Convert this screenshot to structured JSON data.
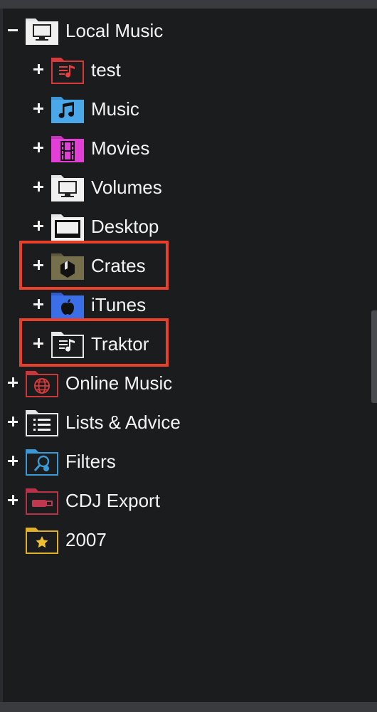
{
  "tree": {
    "items": [
      {
        "label": "Local Music",
        "icon": "computer-folder-icon",
        "expanded": true,
        "level": 0
      },
      {
        "label": "test",
        "icon": "playlist-red-folder-icon",
        "expanded": false,
        "level": 1
      },
      {
        "label": "Music",
        "icon": "music-note-folder-icon",
        "expanded": false,
        "level": 1
      },
      {
        "label": "Movies",
        "icon": "film-folder-icon",
        "expanded": false,
        "level": 1
      },
      {
        "label": "Volumes",
        "icon": "monitor-folder-icon",
        "expanded": false,
        "level": 1
      },
      {
        "label": "Desktop",
        "icon": "desktop-folder-icon",
        "expanded": false,
        "level": 1
      },
      {
        "label": "Crates",
        "icon": "crate-folder-icon",
        "expanded": false,
        "level": 1,
        "highlighted": true
      },
      {
        "label": "iTunes",
        "icon": "apple-folder-icon",
        "expanded": false,
        "level": 1
      },
      {
        "label": "Traktor",
        "icon": "playlist-white-folder-icon",
        "expanded": false,
        "level": 1,
        "highlighted": true
      },
      {
        "label": "Online Music",
        "icon": "globe-folder-icon",
        "expanded": false,
        "level": 0
      },
      {
        "label": "Lists & Advice",
        "icon": "list-folder-icon",
        "expanded": false,
        "level": 0
      },
      {
        "label": "Filters",
        "icon": "filter-search-folder-icon",
        "expanded": false,
        "level": 0
      },
      {
        "label": "CDJ Export",
        "icon": "usb-folder-icon",
        "expanded": false,
        "level": 0
      },
      {
        "label": "2007",
        "icon": "star-folder-icon",
        "expanded": null,
        "level": 0
      }
    ]
  },
  "colors": {
    "background": "#1b1c1e",
    "highlight_border": "#e8402a",
    "music_blue": "#4aa8e8",
    "movies_magenta": "#e23fd6",
    "itunes_blue": "#3a6fe8",
    "online_red": "#c8383a",
    "filters_blue": "#3a9ad8",
    "cdj_crimson": "#b8324a",
    "star_yellow": "#f0c030"
  }
}
